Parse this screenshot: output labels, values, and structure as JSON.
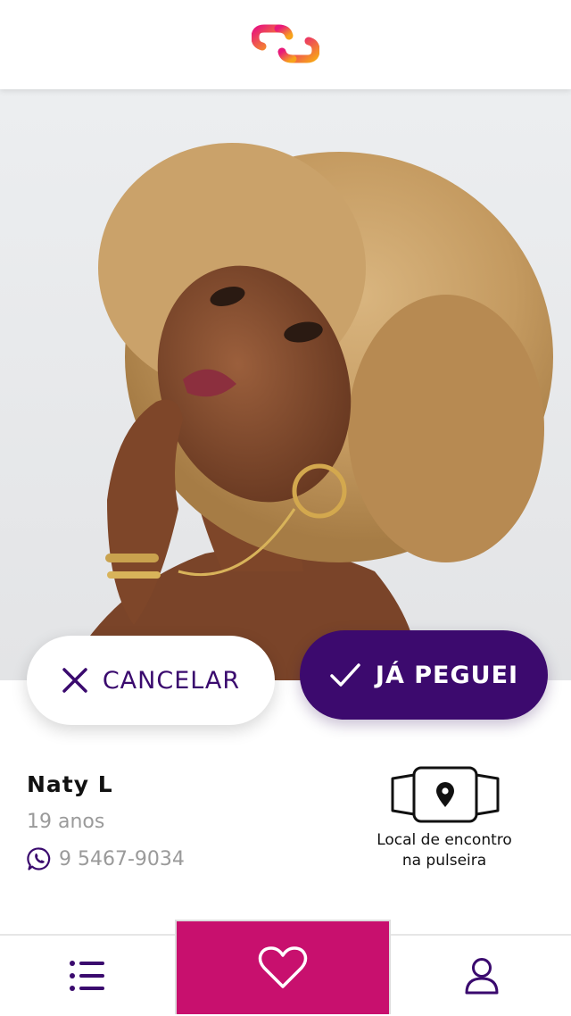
{
  "header": {
    "logo_icon": "chain-link-logo",
    "brand_gradient": [
      "#e8197a",
      "#f7a21b"
    ]
  },
  "actions": {
    "cancel": {
      "label": "CANCELAR",
      "icon": "close-icon",
      "color": "#3a0a6e"
    },
    "confirm": {
      "label": "JÁ PEGUEI",
      "icon": "check-icon",
      "color": "#3c0a6e"
    }
  },
  "profile": {
    "name": "Naty L",
    "age": "19 anos",
    "phone": "9 5467-9034",
    "phone_icon": "whatsapp-icon"
  },
  "meeting": {
    "icon": "bracelet-location-icon",
    "label_line1": "Local de encontro",
    "label_line2": "na pulseira"
  },
  "nav": {
    "items": [
      {
        "icon": "list-icon"
      },
      {
        "icon": "heart-icon",
        "active": true,
        "color": "#c8106e"
      },
      {
        "icon": "user-icon"
      }
    ]
  }
}
